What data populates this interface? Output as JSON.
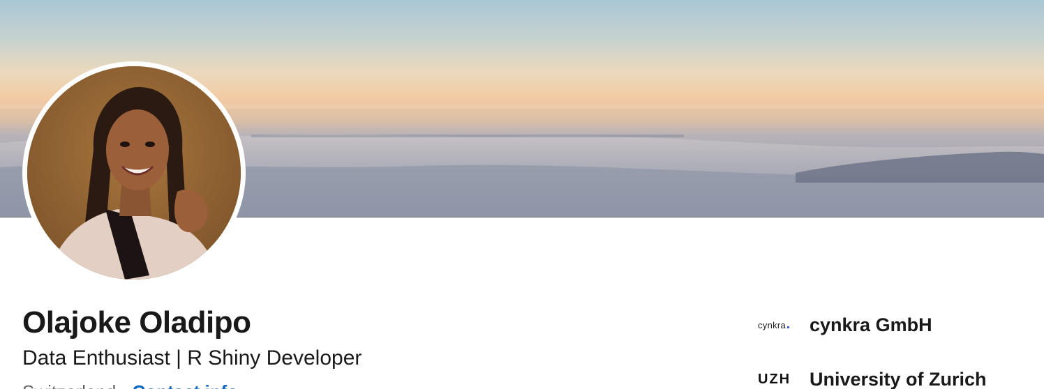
{
  "profile": {
    "name": "Olajoke Oladipo",
    "headline": "Data Enthusiast | R Shiny Developer",
    "location": "Switzerland",
    "separator": "·",
    "contact_info_label": "Contact info"
  },
  "organizations": [
    {
      "logo_text": "cynkra",
      "name": "cynkra GmbH"
    },
    {
      "logo_text": "UZH",
      "name": "University of Zurich"
    }
  ],
  "colors": {
    "link": "#0a66c2",
    "text": "#191919",
    "muted": "#666666"
  },
  "icons": {
    "banner": "cover-photo-sky-clouds",
    "avatar": "profile-photo"
  }
}
